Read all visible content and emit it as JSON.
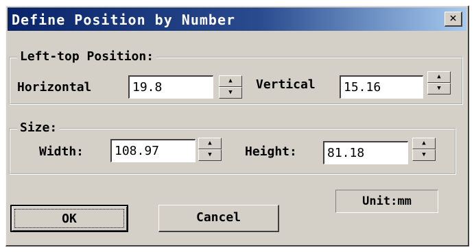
{
  "window": {
    "title": "Define Position by Number",
    "close_glyph": "×"
  },
  "left_top_position": {
    "legend": "Left-top Position:",
    "horizontal_label": "Horizontal",
    "horizontal_value": "19.8",
    "vertical_label": "Vertical",
    "vertical_value": "15.16"
  },
  "size": {
    "legend": "Size:",
    "width_label": "Width:",
    "width_value": "108.97",
    "height_label": "Height:",
    "height_value": "81.18"
  },
  "unit_label": "Unit:mm",
  "buttons": {
    "ok": "OK",
    "cancel": "Cancel"
  },
  "icons": {
    "close": "close-icon",
    "spin_up": "triangle-up",
    "spin_down": "triangle-down"
  },
  "colors": {
    "title_start": "#0a246a",
    "title_end": "#a6caf0",
    "face": "#d4d0c8"
  }
}
